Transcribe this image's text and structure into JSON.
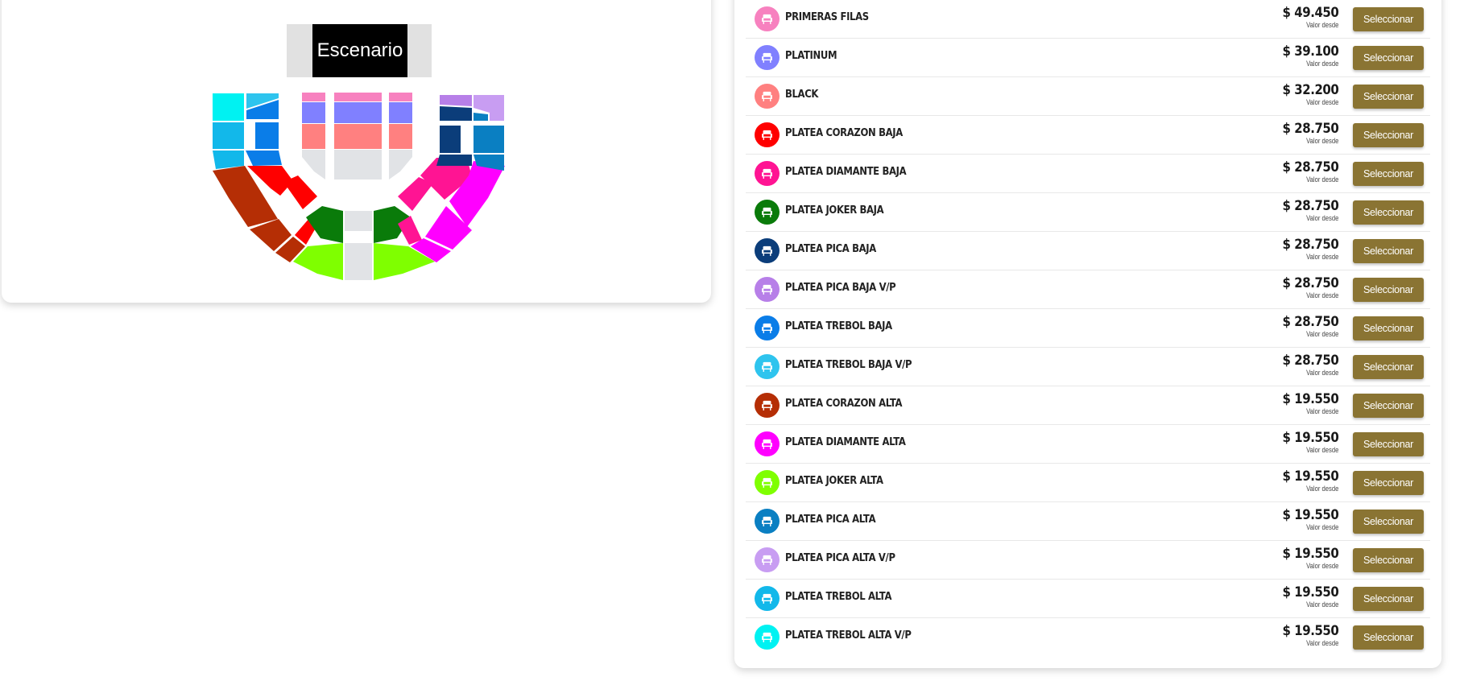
{
  "venue_map": {
    "stage_label": "Escenario"
  },
  "list": {
    "price_note": "Valor desde",
    "button_label": "Seleccionar",
    "categories": [
      {
        "name": "PRIMERAS FILAS",
        "price": "$ 49.450",
        "color": "#f781bf"
      },
      {
        "name": "PLATINUM",
        "price": "$ 39.100",
        "color": "#8080ff"
      },
      {
        "name": "BLACK",
        "price": "$ 32.200",
        "color": "#ff8080"
      },
      {
        "name": "PLATEA CORAZON BAJA",
        "price": "$ 28.750",
        "color": "#ff0000"
      },
      {
        "name": "PLATEA DIAMANTE BAJA",
        "price": "$ 28.750",
        "color": "#ff1493"
      },
      {
        "name": "PLATEA JOKER BAJA",
        "price": "$ 28.750",
        "color": "#0a7b0a"
      },
      {
        "name": "PLATEA PICA BAJA",
        "price": "$ 28.750",
        "color": "#0b3d7a"
      },
      {
        "name": "PLATEA PICA BAJA V/P",
        "price": "$ 28.750",
        "color": "#b77fe8"
      },
      {
        "name": "PLATEA TREBOL BAJA",
        "price": "$ 28.750",
        "color": "#0a7de8"
      },
      {
        "name": "PLATEA TREBOL BAJA V/P",
        "price": "$ 28.750",
        "color": "#2ec4ee"
      },
      {
        "name": "PLATEA CORAZON ALTA",
        "price": "$ 19.550",
        "color": "#b52e05"
      },
      {
        "name": "PLATEA DIAMANTE ALTA",
        "price": "$ 19.550",
        "color": "#ff00ff"
      },
      {
        "name": "PLATEA JOKER ALTA",
        "price": "$ 19.550",
        "color": "#7fff00"
      },
      {
        "name": "PLATEA PICA ALTA",
        "price": "$ 19.550",
        "color": "#0a7fc2"
      },
      {
        "name": "PLATEA PICA ALTA V/P",
        "price": "$ 19.550",
        "color": "#c89df2"
      },
      {
        "name": "PLATEA TREBOL ALTA",
        "price": "$ 19.550",
        "color": "#12b8ea"
      },
      {
        "name": "PLATEA TREBOL ALTA V/P",
        "price": "$ 19.550",
        "color": "#00f2f2"
      }
    ]
  }
}
